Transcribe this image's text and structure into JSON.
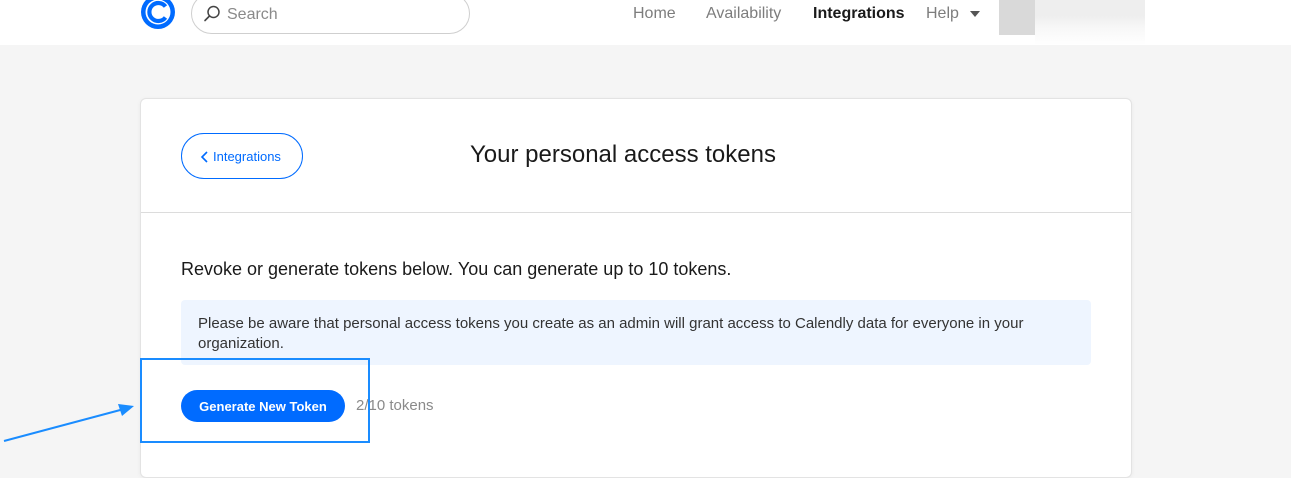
{
  "nav": {
    "search_placeholder": "Search",
    "links": {
      "home": "Home",
      "availability": "Availability",
      "integrations": "Integrations",
      "help": "Help"
    },
    "active": "Integrations"
  },
  "card": {
    "back_label": "Integrations",
    "title": "Your personal access tokens",
    "intro": "Revoke or generate tokens below. You can generate up to 10 tokens.",
    "notice": "Please be aware that personal access tokens you create as an admin will grant access to Calendly data for everyone in your organization.",
    "generate_label": "Generate New Token",
    "token_count": "2/10 tokens"
  },
  "colors": {
    "brand_blue": "#006bff",
    "notice_bg": "#eef5ff",
    "annotation_blue": "#1a8cff"
  },
  "icons": {
    "logo": "calendly-logo",
    "search": "search-icon",
    "help_caret": "caret-down-icon",
    "back": "chevron-left-icon"
  }
}
